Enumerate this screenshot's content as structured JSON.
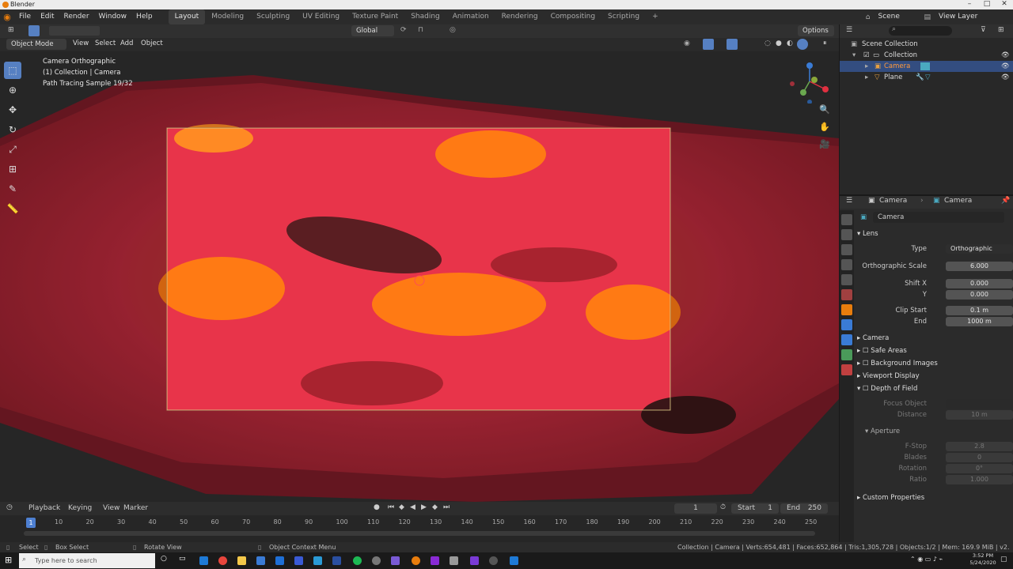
{
  "window": {
    "title": "Blender",
    "controls": [
      "–",
      "□",
      "✕"
    ]
  },
  "menubar": {
    "menus": [
      "File",
      "Edit",
      "Render",
      "Window",
      "Help"
    ],
    "workspaces": [
      "Layout",
      "Modeling",
      "Sculpting",
      "UV Editing",
      "Texture Paint",
      "Shading",
      "Animation",
      "Rendering",
      "Compositing",
      "Scripting"
    ],
    "active_workspace": "Layout",
    "add_tab": "+",
    "scene": "Scene",
    "view_layer": "View Layer"
  },
  "tool_header": {
    "orientation": "Global",
    "options": "Options"
  },
  "viewport_header": {
    "mode": "Object Mode",
    "menus": [
      "View",
      "Select",
      "Add",
      "Object"
    ]
  },
  "viewport": {
    "overlay_lines": [
      "Camera Orthographic",
      "(1) Collection | Camera",
      "Path Tracing Sample 19/32"
    ]
  },
  "outliner": {
    "rows": [
      {
        "label": "Scene Collection",
        "indent": 0,
        "selected": false
      },
      {
        "label": "Collection",
        "indent": 1,
        "selected": false
      },
      {
        "label": "Camera",
        "indent": 2,
        "selected": true
      },
      {
        "label": "Plane",
        "indent": 2,
        "selected": false
      }
    ]
  },
  "properties": {
    "breadcrumb_object": "Camera",
    "breadcrumb_data": "Camera",
    "datablock": "Camera",
    "lens_header": "Lens",
    "type_label": "Type",
    "type_value": "Orthographic",
    "ortho_scale_label": "Orthographic Scale",
    "ortho_scale_value": "6.000",
    "shift_x_label": "Shift X",
    "shift_x_value": "0.000",
    "shift_y_label": "Y",
    "shift_y_value": "0.000",
    "clip_start_label": "Clip Start",
    "clip_start_value": "0.1 m",
    "clip_end_label": "End",
    "clip_end_value": "1000 m",
    "camera_section": "Camera",
    "safe_areas": "Safe Areas",
    "background_images": "Background Images",
    "viewport_display": "Viewport Display",
    "depth_of_field": "Depth of Field",
    "focus_object_label": "Focus Object",
    "distance_label": "Distance",
    "distance_value": "10 m",
    "aperture": "Aperture",
    "fstop_label": "F-Stop",
    "fstop_value": "2.8",
    "blades_label": "Blades",
    "blades_value": "0",
    "rotation_label": "Rotation",
    "rotation_value": "0°",
    "ratio_label": "Ratio",
    "ratio_value": "1.000",
    "custom_properties": "Custom Properties"
  },
  "timeline": {
    "menus": [
      "Playback",
      "Keying",
      "View",
      "Marker"
    ],
    "current_frame": "1",
    "start_label": "Start",
    "start_value": "1",
    "end_label": "End",
    "end_value": "250",
    "playhead": "1",
    "ticks": [
      "10",
      "20",
      "30",
      "40",
      "50",
      "60",
      "70",
      "80",
      "90",
      "100",
      "110",
      "120",
      "130",
      "140",
      "150",
      "160",
      "170",
      "180",
      "190",
      "200",
      "210",
      "220",
      "230",
      "240",
      "250"
    ]
  },
  "statusbar": {
    "select": "Select",
    "box_select": "Box Select",
    "rotate_view": "Rotate View",
    "context_menu": "Object Context Menu",
    "stats": "Collection | Camera | Verts:654,481 | Faces:652,864 | Tris:1,305,728 | Objects:1/2 | Mem: 169.9 MiB | v2.82.7"
  },
  "taskbar": {
    "search_placeholder": "Type here to search",
    "time": "3:52 PM",
    "date": "5/24/2020"
  },
  "colors": {
    "accent": "#4d7fd1",
    "selection": "#334d80",
    "terrain_red": "#e8344a",
    "terrain_orange": "#ff7a14"
  }
}
